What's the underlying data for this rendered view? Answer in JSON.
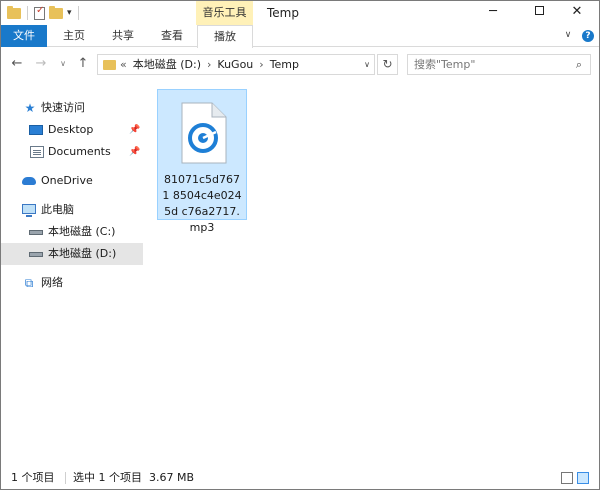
{
  "title_bar": {
    "context_tab": "音乐工具",
    "window_title": "Temp",
    "minimize": "─",
    "close": "✕"
  },
  "ribbon": {
    "tabs": [
      "文件",
      "主页",
      "共享",
      "查看",
      "播放"
    ],
    "active_tab": "播放",
    "help": "?"
  },
  "nav": {
    "back": "←",
    "forward": "→",
    "recent": "∨",
    "up": "↑",
    "refresh": "↻"
  },
  "address": {
    "crumbs": [
      "«",
      "本地磁盘 (D:)",
      "›",
      "KuGou",
      "›",
      "Temp"
    ],
    "dropdown": "∨"
  },
  "search": {
    "placeholder": "搜索\"Temp\"",
    "icon": "search-icon"
  },
  "sidebar": {
    "items": [
      {
        "label": "快速访问",
        "icon": "star-icon"
      },
      {
        "label": "Desktop",
        "icon": "desktop-icon",
        "pinned": true
      },
      {
        "label": "Documents",
        "icon": "documents-icon",
        "pinned": true
      },
      {
        "label": "OneDrive",
        "icon": "cloud-icon"
      },
      {
        "label": "此电脑",
        "icon": "computer-icon"
      },
      {
        "label": "本地磁盘 (C:)",
        "icon": "drive-icon"
      },
      {
        "label": "本地磁盘 (D:)",
        "icon": "drive-icon",
        "highlighted": true
      },
      {
        "label": "网络",
        "icon": "network-icon"
      }
    ]
  },
  "files": [
    {
      "name": "81071c5d7671 8504c4e0245d c76a2717.mp3",
      "icon": "audio-file-icon",
      "selected": true
    }
  ],
  "status": {
    "count": "1 个项目",
    "selected": "选中 1 个项目",
    "size": "3.67 MB"
  },
  "colors": {
    "accent": "#1979ca",
    "context_tab": "#fff1b8",
    "selection": "#cce8ff",
    "folder": "#e8c15a"
  }
}
